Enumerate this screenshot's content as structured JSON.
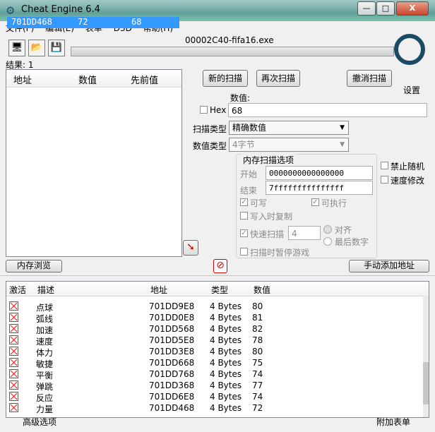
{
  "window": {
    "title": "Cheat Engine 6.4",
    "min": "—",
    "max": "□",
    "close": "X"
  },
  "menu": [
    "文件(F)",
    "编辑(E)",
    "表单",
    "D3D",
    "帮助(H)"
  ],
  "process_name": "00002C40-fifa16.exe",
  "results_label": "结果: 1",
  "found_list": {
    "headers": [
      "地址",
      "数值",
      "先前值"
    ],
    "rows": [
      {
        "address": "701DD468",
        "value": "72",
        "previous": "68"
      }
    ]
  },
  "buttons": {
    "new_scan": "新的扫描",
    "next_scan": "再次扫描",
    "undo_scan": "撤消扫描",
    "settings": "设置",
    "memory_view": "内存浏览",
    "add_manual": "手动添加地址"
  },
  "scan": {
    "value_label": "数值:",
    "hex_label": "Hex",
    "value": "68",
    "scan_type_label": "扫描类型",
    "scan_type": "精确数值",
    "value_type_label": "数值类型",
    "value_type": "4字节",
    "mem_options_title": "内存扫描选项",
    "start_label": "开始",
    "start": "0000000000000000",
    "stop_label": "结束",
    "stop": "7fffffffffffffff",
    "writable": "可写",
    "executable": "可执行",
    "copy_on_write": "写入时复制",
    "fast_scan": "快速扫描",
    "fast_scan_value": "4",
    "align": "对齐",
    "last_digits": "最后数字",
    "pause_game": "扫描时暂停游戏",
    "no_random": "禁止随机",
    "speedhack": "速度修改"
  },
  "cheat_table": {
    "headers": [
      "激活",
      "描述",
      "地址",
      "类型",
      "数值"
    ],
    "rows": [
      {
        "desc": "点球",
        "address": "701DD9E8",
        "type": "4 Bytes",
        "value": "80"
      },
      {
        "desc": "弧线",
        "address": "701DD0E8",
        "type": "4 Bytes",
        "value": "81"
      },
      {
        "desc": "加速",
        "address": "701DD568",
        "type": "4 Bytes",
        "value": "82"
      },
      {
        "desc": "速度",
        "address": "701DD5E8",
        "type": "4 Bytes",
        "value": "78"
      },
      {
        "desc": "体力",
        "address": "701DD3E8",
        "type": "4 Bytes",
        "value": "80"
      },
      {
        "desc": "敏捷",
        "address": "701DD668",
        "type": "4 Bytes",
        "value": "75"
      },
      {
        "desc": "平衡",
        "address": "701DD768",
        "type": "4 Bytes",
        "value": "74"
      },
      {
        "desc": "弹跳",
        "address": "701DD368",
        "type": "4 Bytes",
        "value": "77"
      },
      {
        "desc": "反应",
        "address": "701DD6E8",
        "type": "4 Bytes",
        "value": "74"
      },
      {
        "desc": "力量",
        "address": "701DD468",
        "type": "4 Bytes",
        "value": "72"
      }
    ]
  },
  "footer": {
    "advanced": "高级选项",
    "append": "附加表单"
  }
}
